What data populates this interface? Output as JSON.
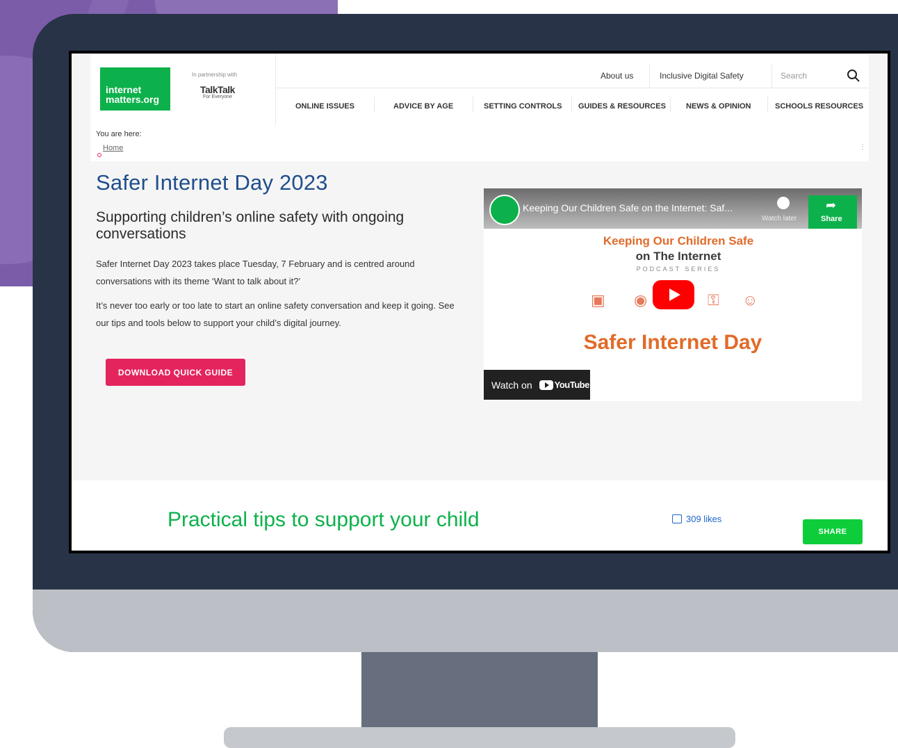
{
  "header": {
    "logo_line1": "internet",
    "logo_line2": "matters.org",
    "partnership": "In partnership with",
    "partner_name": "TalkTalk",
    "partner_tagline": "For Everyone",
    "top_links": [
      "About us",
      "Inclusive Digital Safety"
    ],
    "search_placeholder": "Search",
    "main_nav": [
      "ONLINE ISSUES",
      "ADVICE BY AGE",
      "SETTING CONTROLS",
      "GUIDES & RESOURCES",
      "NEWS & OPINION",
      "SCHOOLS RESOURCES"
    ]
  },
  "breadcrumb": {
    "label": "You are here:",
    "home": "Home"
  },
  "content": {
    "title": "Safer Internet Day 2023",
    "subtitle": "Supporting children’s online safety with ongoing conversations",
    "para1": "Safer Internet Day 2023 takes place Tuesday, 7 February and is centred around conversations with its theme ‘Want to talk about it?’",
    "para2": "It’s never too early or too late to start an online safety conversation and keep it going. See our tips and tools below to support your child’s digital journey.",
    "download_label": "DOWNLOAD QUICK GUIDE"
  },
  "video": {
    "title": "Keeping Our Children Safe on the Internet: Saf...",
    "watch_later": "Watch later",
    "share": "Share",
    "heading_line1": "Keeping Our Children Safe",
    "heading_line2": "on The Internet",
    "series": "PODCAST SERIES",
    "banner": "Safer Internet Day",
    "watch_on": "Watch on",
    "youtube": "YouTube"
  },
  "bottom": {
    "heading": "Practical tips to support your child",
    "likes": "309 likes",
    "share_label": "SHARE"
  },
  "colors": {
    "brand_green": "#0db14b",
    "title_blue": "#1f4e8c",
    "cta_pink": "#e3245d",
    "monitor_frame": "#283347",
    "backdrop_purple": "#7b5ca8"
  }
}
